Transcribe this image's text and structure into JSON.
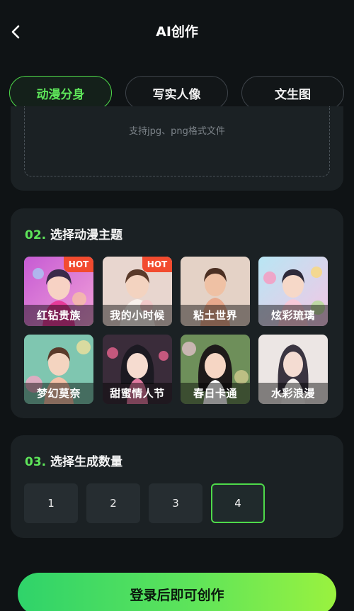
{
  "header": {
    "title": "AI创作",
    "back_icon": "chevron-left-icon"
  },
  "tabs": [
    {
      "label": "动漫分身",
      "active": true
    },
    {
      "label": "写实人像",
      "active": false
    },
    {
      "label": "文生图",
      "active": false
    }
  ],
  "upload": {
    "hint": "支持jpg、png格式文件"
  },
  "theme_section": {
    "num": "02.",
    "title": "选择动漫主题",
    "themes": [
      {
        "label": "红钻贵族",
        "badge": "HOT",
        "selected": true
      },
      {
        "label": "我的小时候",
        "badge": "HOT",
        "selected": false
      },
      {
        "label": "粘土世界",
        "badge": "",
        "selected": false
      },
      {
        "label": "炫彩琉璃",
        "badge": "",
        "selected": false
      },
      {
        "label": "梦幻莫奈",
        "badge": "",
        "selected": false
      },
      {
        "label": "甜蜜情人节",
        "badge": "",
        "selected": false
      },
      {
        "label": "春日卡通",
        "badge": "",
        "selected": false
      },
      {
        "label": "水彩浪漫",
        "badge": "",
        "selected": false
      }
    ]
  },
  "quantity_section": {
    "num": "03.",
    "title": "选择生成数量",
    "options": [
      "1",
      "2",
      "3",
      "4"
    ],
    "selected": "4"
  },
  "submit": {
    "label": "登录后即可创作"
  },
  "colors": {
    "accent": "#4ed94a",
    "hot": "#f24b2f",
    "background": "#0f1315",
    "card": "#1b2124"
  }
}
